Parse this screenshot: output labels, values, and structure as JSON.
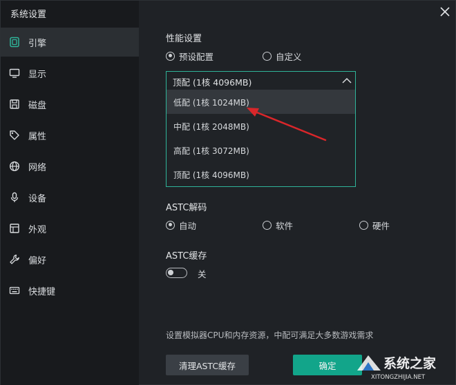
{
  "window": {
    "title": "系统设置"
  },
  "sidebar": {
    "items": [
      {
        "label": "引擎",
        "icon": "engine-icon",
        "active": true
      },
      {
        "label": "显示",
        "icon": "monitor-icon"
      },
      {
        "label": "磁盘",
        "icon": "disk-icon"
      },
      {
        "label": "属性",
        "icon": "tag-icon"
      },
      {
        "label": "网络",
        "icon": "globe-icon"
      },
      {
        "label": "设备",
        "icon": "microphone-icon"
      },
      {
        "label": "外观",
        "icon": "appearance-icon"
      },
      {
        "label": "偏好",
        "icon": "wrench-icon"
      },
      {
        "label": "快捷键",
        "icon": "keyboard-icon"
      }
    ]
  },
  "performance": {
    "title": "性能设置",
    "radio_preset": "预设配置",
    "radio_custom": "自定义",
    "selected": "顶配 (1核 4096MB)",
    "options": [
      "低配 (1核 1024MB)",
      "中配 (1核 2048MB)",
      "高配 (1核 3072MB)",
      "顶配 (1核 4096MB)"
    ]
  },
  "astc_decode": {
    "title": "ASTC解码",
    "auto": "自动",
    "software": "软件",
    "hardware": "硬件"
  },
  "astc_cache": {
    "title": "ASTC缓存",
    "toggle_label": "关"
  },
  "footer": {
    "hint": "设置模拟器CPU和内存资源，中配可满足大多数游戏需求",
    "clear_button": "清理ASTC缓存",
    "ok_button": "确定"
  },
  "watermark": {
    "brand": "系统之家",
    "url": "XITONGZHIJIA.NET"
  },
  "colors": {
    "accent": "#2fb59a",
    "ok_button": "#12a58a",
    "annotation_arrow": "#d9262a"
  }
}
